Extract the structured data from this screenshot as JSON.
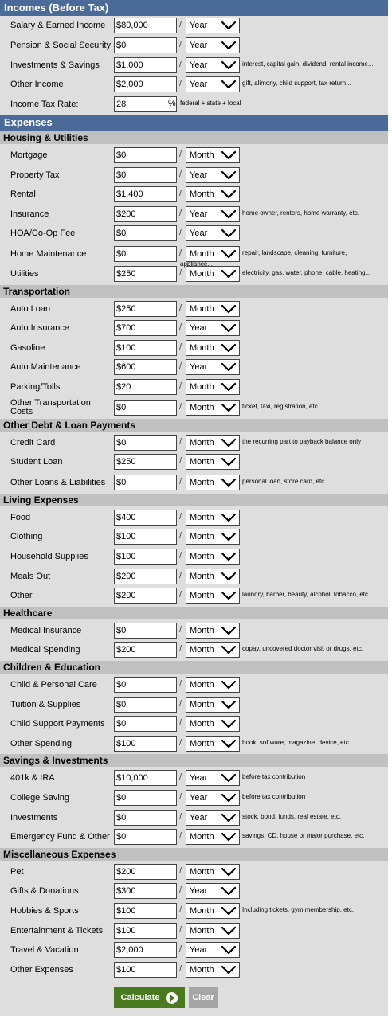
{
  "incomes": {
    "title": "Incomes (Before Tax)",
    "rows": [
      {
        "label": "Salary & Earned Income",
        "value": "$80,000",
        "period": "Year",
        "note": ""
      },
      {
        "label": "Pension & Social Security",
        "value": "$0",
        "period": "Year",
        "note": ""
      },
      {
        "label": "Investments & Savings",
        "value": "$1,000",
        "period": "Year",
        "note": "interest, capital gain, dividend, rental income..."
      },
      {
        "label": "Other Income",
        "value": "$2,000",
        "period": "Year",
        "note": "gift, alimony, child support, tax return..."
      }
    ],
    "tax": {
      "label": "Income Tax Rate:",
      "value": "28",
      "unit": "%",
      "note": "federal + state + local"
    }
  },
  "expenses_title": "Expenses",
  "sections": [
    {
      "title": "Housing & Utilities",
      "rows": [
        {
          "label": "Mortgage",
          "value": "$0",
          "period": "Month",
          "note": ""
        },
        {
          "label": "Property Tax",
          "value": "$0",
          "period": "Year",
          "note": ""
        },
        {
          "label": "Rental",
          "value": "$1,400",
          "period": "Month",
          "note": ""
        },
        {
          "label": "Insurance",
          "value": "$200",
          "period": "Year",
          "note": "home owner, renters, home warranty, etc."
        },
        {
          "label": "HOA/Co-Op Fee",
          "value": "$0",
          "period": "Year",
          "note": ""
        },
        {
          "label": "Home Maintenance",
          "value": "$0",
          "period": "Month",
          "note": "repair, landscape, cleaning, furniture, appliance..."
        },
        {
          "label": "Utilities",
          "value": "$250",
          "period": "Month",
          "note": "electricity, gas, water, phone, cable, heating..."
        }
      ]
    },
    {
      "title": "Transportation",
      "rows": [
        {
          "label": "Auto Loan",
          "value": "$250",
          "period": "Month",
          "note": ""
        },
        {
          "label": "Auto Insurance",
          "value": "$700",
          "period": "Year",
          "note": ""
        },
        {
          "label": "Gasoline",
          "value": "$100",
          "period": "Month",
          "note": ""
        },
        {
          "label": "Auto Maintenance",
          "value": "$600",
          "period": "Year",
          "note": ""
        },
        {
          "label": "Parking/Tolls",
          "value": "$20",
          "period": "Month",
          "note": ""
        },
        {
          "label": "Other Transportation Costs",
          "value": "$0",
          "period": "Month",
          "note": "ticket, taxi, registration, etc."
        }
      ]
    },
    {
      "title": "Other Debt & Loan Payments",
      "rows": [
        {
          "label": "Credit Card",
          "value": "$0",
          "period": "Month",
          "note": "the recurring part to payback balance only"
        },
        {
          "label": "Student Loan",
          "value": "$250",
          "period": "Month",
          "note": ""
        },
        {
          "label": "Other Loans & Liabilities",
          "value": "$0",
          "period": "Month",
          "note": "personal loan, store card, etc."
        }
      ]
    },
    {
      "title": "Living Expenses",
      "rows": [
        {
          "label": "Food",
          "value": "$400",
          "period": "Month",
          "note": ""
        },
        {
          "label": "Clothing",
          "value": "$100",
          "period": "Month",
          "note": ""
        },
        {
          "label": "Household Supplies",
          "value": "$100",
          "period": "Month",
          "note": ""
        },
        {
          "label": "Meals Out",
          "value": "$200",
          "period": "Month",
          "note": ""
        },
        {
          "label": "Other",
          "value": "$200",
          "period": "Month",
          "note": "laundry, barber, beauty, alcohol, tobacco, etc."
        }
      ]
    },
    {
      "title": "Healthcare",
      "rows": [
        {
          "label": "Medical Insurance",
          "value": "$0",
          "period": "Month",
          "note": ""
        },
        {
          "label": "Medical Spending",
          "value": "$200",
          "period": "Month",
          "note": "copay, uncovered doctor visit or drugs, etc."
        }
      ]
    },
    {
      "title": "Children & Education",
      "rows": [
        {
          "label": "Child & Personal Care",
          "value": "$0",
          "period": "Month",
          "note": ""
        },
        {
          "label": "Tuition & Supplies",
          "value": "$0",
          "period": "Month",
          "note": ""
        },
        {
          "label": "Child Support Payments",
          "value": "$0",
          "period": "Month",
          "note": ""
        },
        {
          "label": "Other Spending",
          "value": "$100",
          "period": "Month",
          "note": "book, software, magazine, device, etc."
        }
      ]
    },
    {
      "title": "Savings & Investments",
      "rows": [
        {
          "label": "401k & IRA",
          "value": "$10,000",
          "period": "Year",
          "note": "before tax contribution"
        },
        {
          "label": "College Saving",
          "value": "$0",
          "period": "Year",
          "note": "before tax contribution"
        },
        {
          "label": "Investments",
          "value": "$0",
          "period": "Year",
          "note": "stock, bond, funds, real estate, etc."
        },
        {
          "label": "Emergency Fund & Other",
          "value": "$0",
          "period": "Month",
          "note": "savings, CD, house or major purchase, etc."
        }
      ]
    },
    {
      "title": "Miscellaneous Expenses",
      "rows": [
        {
          "label": "Pet",
          "value": "$200",
          "period": "Month",
          "note": ""
        },
        {
          "label": "Gifts & Donations",
          "value": "$300",
          "period": "Year",
          "note": ""
        },
        {
          "label": "Hobbies & Sports",
          "value": "$100",
          "period": "Month",
          "note": "Including tickets, gym membership, etc."
        },
        {
          "label": "Entertainment & Tickets",
          "value": "$100",
          "period": "Month",
          "note": ""
        },
        {
          "label": "Travel & Vacation",
          "value": "$2,000",
          "period": "Year",
          "note": ""
        },
        {
          "label": "Other Expenses",
          "value": "$100",
          "period": "Month",
          "note": ""
        }
      ]
    }
  ],
  "buttons": {
    "calculate": "Calculate",
    "clear": "Clear"
  },
  "separator": "/",
  "icons": {
    "select": "chevron-down-icon",
    "calculate": "play-icon"
  },
  "colors": {
    "banner": "#4a6a9a",
    "subhead": "#c0c0c0",
    "calculate": "#4a7a1e",
    "clear": "#a5a5a5"
  }
}
